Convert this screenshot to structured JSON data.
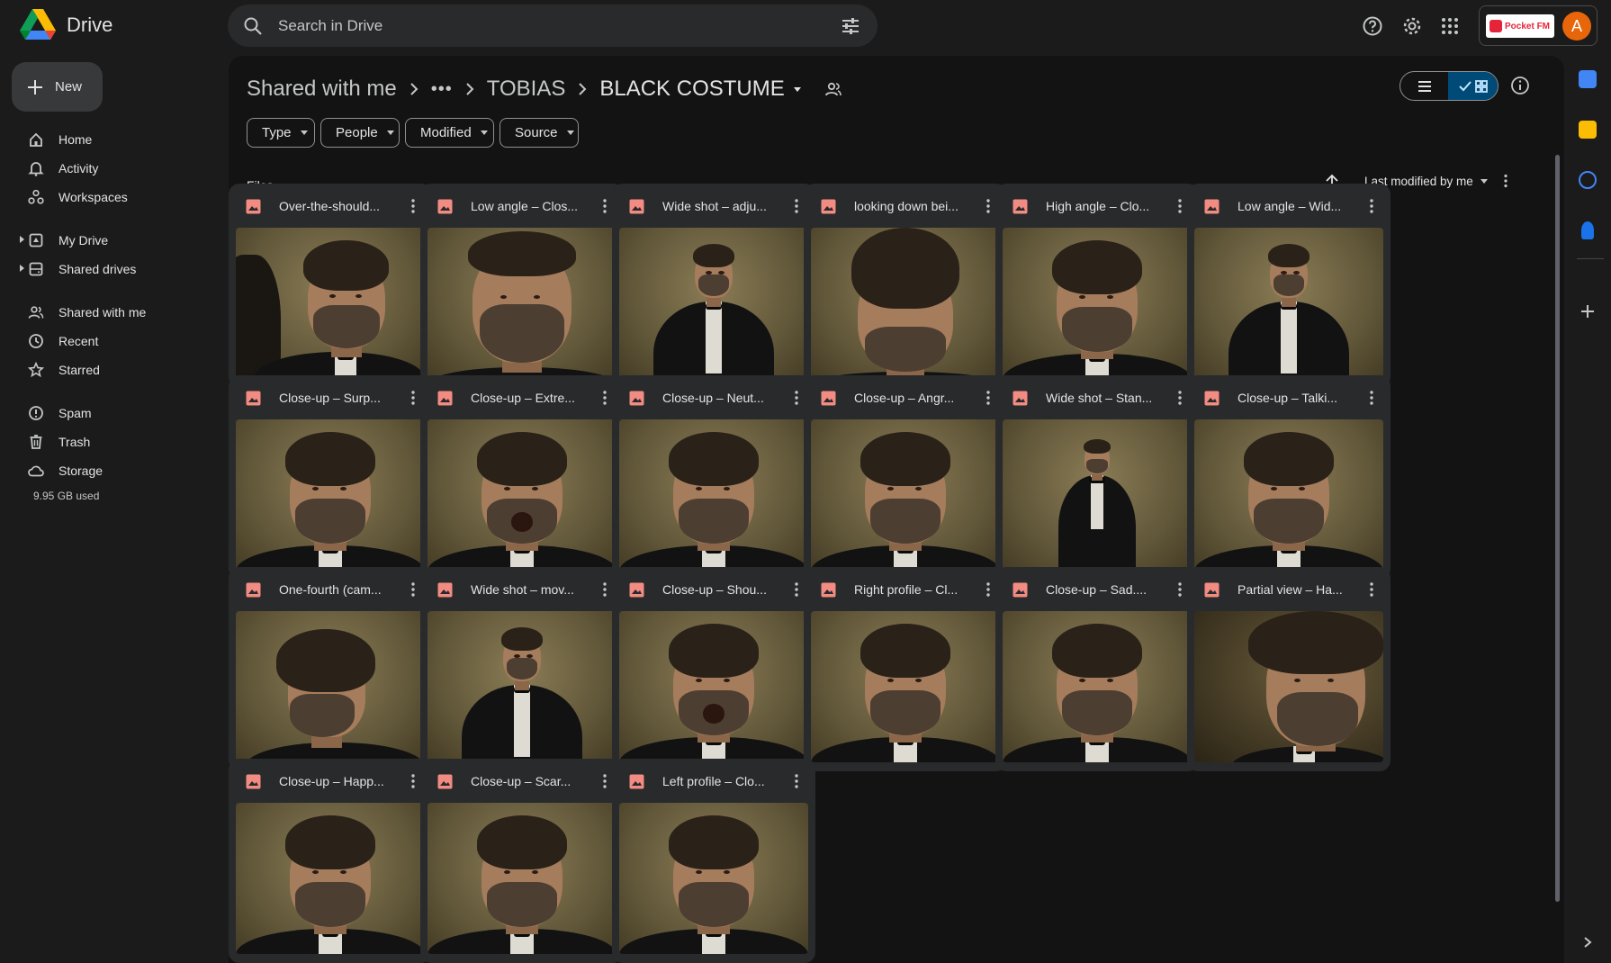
{
  "app": {
    "name": "Drive"
  },
  "search": {
    "placeholder": "Search in Drive"
  },
  "account": {
    "brand_label": "Pocket FM",
    "avatar_letter": "A",
    "avatar_color": "#e8660a"
  },
  "sidebar": {
    "new_label": "New",
    "items": [
      {
        "label": "Home",
        "icon": "home-icon"
      },
      {
        "label": "Activity",
        "icon": "bell-icon"
      },
      {
        "label": "Workspaces",
        "icon": "workspaces-icon"
      },
      {
        "label": "My Drive",
        "icon": "my-drive-icon"
      },
      {
        "label": "Shared drives",
        "icon": "shared-drives-icon"
      },
      {
        "label": "Shared with me",
        "icon": "people-icon"
      },
      {
        "label": "Recent",
        "icon": "clock-icon"
      },
      {
        "label": "Starred",
        "icon": "star-icon"
      },
      {
        "label": "Spam",
        "icon": "spam-icon"
      },
      {
        "label": "Trash",
        "icon": "trash-icon"
      },
      {
        "label": "Storage",
        "icon": "cloud-icon"
      }
    ],
    "storage_used": "9.95 GB used"
  },
  "breadcrumb": {
    "root": "Shared with me",
    "ellipsis": "•••",
    "parent": "TOBIAS",
    "current": "BLACK COSTUME"
  },
  "filters": [
    {
      "label": "Type"
    },
    {
      "label": "People"
    },
    {
      "label": "Modified"
    },
    {
      "label": "Source"
    }
  ],
  "files_section": {
    "label": "Files",
    "sort_label": "Last modified by me"
  },
  "files": [
    {
      "name": "Over-the-should...",
      "pose": "ots"
    },
    {
      "name": "Low angle – Clos...",
      "pose": "lowclose"
    },
    {
      "name": "Wide shot – adju...",
      "pose": "wide"
    },
    {
      "name": "looking down bei...",
      "pose": "down"
    },
    {
      "name": "High angle – Clo...",
      "pose": "close"
    },
    {
      "name": "Low angle – Wid...",
      "pose": "wide"
    },
    {
      "name": "Close-up – Surp...",
      "pose": "close"
    },
    {
      "name": "Close-up – Extre...",
      "pose": "shout"
    },
    {
      "name": "Close-up – Neut...",
      "pose": "close"
    },
    {
      "name": "Close-up – Angr...",
      "pose": "close"
    },
    {
      "name": "Wide shot – Stan...",
      "pose": "full"
    },
    {
      "name": "Close-up – Talki...",
      "pose": "close"
    },
    {
      "name": "One-fourth (cam...",
      "pose": "profile"
    },
    {
      "name": "Wide shot – mov...",
      "pose": "wide"
    },
    {
      "name": "Close-up – Shou...",
      "pose": "shout"
    },
    {
      "name": "Right profile – Cl...",
      "pose": "close"
    },
    {
      "name": "Close-up – Sad....",
      "pose": "close"
    },
    {
      "name": "Partial view – Ha...",
      "pose": "partial"
    },
    {
      "name": "Close-up – Happ...",
      "pose": "close"
    },
    {
      "name": "Close-up – Scar...",
      "pose": "close"
    },
    {
      "name": "Left profile – Clo...",
      "pose": "close"
    }
  ],
  "colors": {
    "image_icon": "#f28b82",
    "accent": "#a8c7fa",
    "selected_toggle": "#004a77"
  }
}
